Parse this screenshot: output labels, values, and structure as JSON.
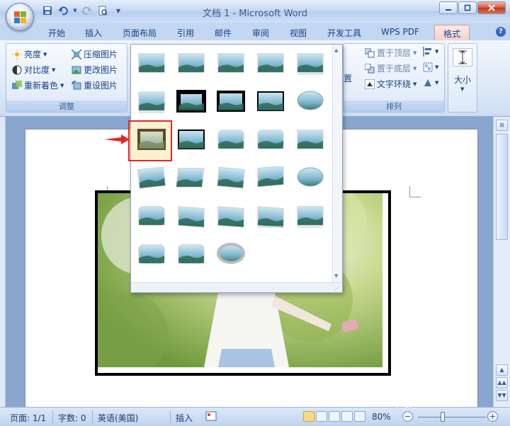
{
  "window": {
    "title": "文档 1 - Microsoft Word",
    "controls": [
      "minimize",
      "maximize",
      "close"
    ]
  },
  "quick_access": [
    "save-icon",
    "undo-icon",
    "redo-icon",
    "print-preview-icon",
    "customize-icon"
  ],
  "tabs": [
    {
      "label": "开始"
    },
    {
      "label": "插入"
    },
    {
      "label": "页面布局"
    },
    {
      "label": "引用"
    },
    {
      "label": "邮件"
    },
    {
      "label": "审阅"
    },
    {
      "label": "视图"
    },
    {
      "label": "开发工具"
    },
    {
      "label": "WPS PDF"
    },
    {
      "label": "格式",
      "active": true
    }
  ],
  "ribbon": {
    "adjust": {
      "items": [
        "亮度",
        "对比度",
        "重新着色",
        "压缩图片",
        "更改图片",
        "重设图片"
      ],
      "label": "调整"
    },
    "arrange": {
      "items": [
        "置于顶层",
        "置于底层",
        "文字环绕",
        "置"
      ],
      "label": "排列"
    },
    "size": {
      "label": "大小"
    }
  },
  "status": {
    "page": "页面: 1/1",
    "words": "字数: 0",
    "language": "英语(美国)",
    "mode": "插入",
    "zoom": "80%"
  },
  "watermark": {
    "brand": "Baidu经验",
    "url": "jingyan.baidu.com"
  },
  "colors": {
    "accent": "#e3272b",
    "ribbon": "#dbe7f7",
    "active_tab": "#f3d2cc"
  }
}
